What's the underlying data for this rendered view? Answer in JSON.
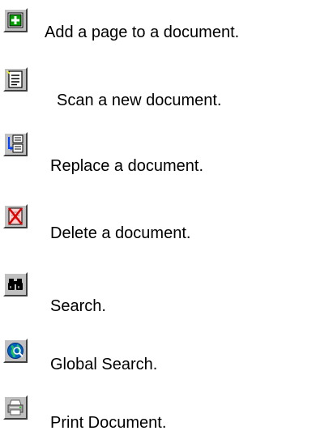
{
  "items": [
    {
      "icon": "add-page-icon",
      "label": "Add a page to a document."
    },
    {
      "icon": "scan-document-icon",
      "label": "Scan a new document."
    },
    {
      "icon": "replace-document-icon",
      "label": "Replace a document."
    },
    {
      "icon": "delete-document-icon",
      "label": "Delete a document."
    },
    {
      "icon": "binoculars-search-icon",
      "label": "Search."
    },
    {
      "icon": "globe-search-icon",
      "label": "Global Search."
    },
    {
      "icon": "printer-icon",
      "label": "Print Document."
    }
  ],
  "colors": {
    "button_face": "#c0c0c0",
    "add_green": "#00a000",
    "delete_red": "#e00000",
    "globe_blue": "#0060c0"
  }
}
